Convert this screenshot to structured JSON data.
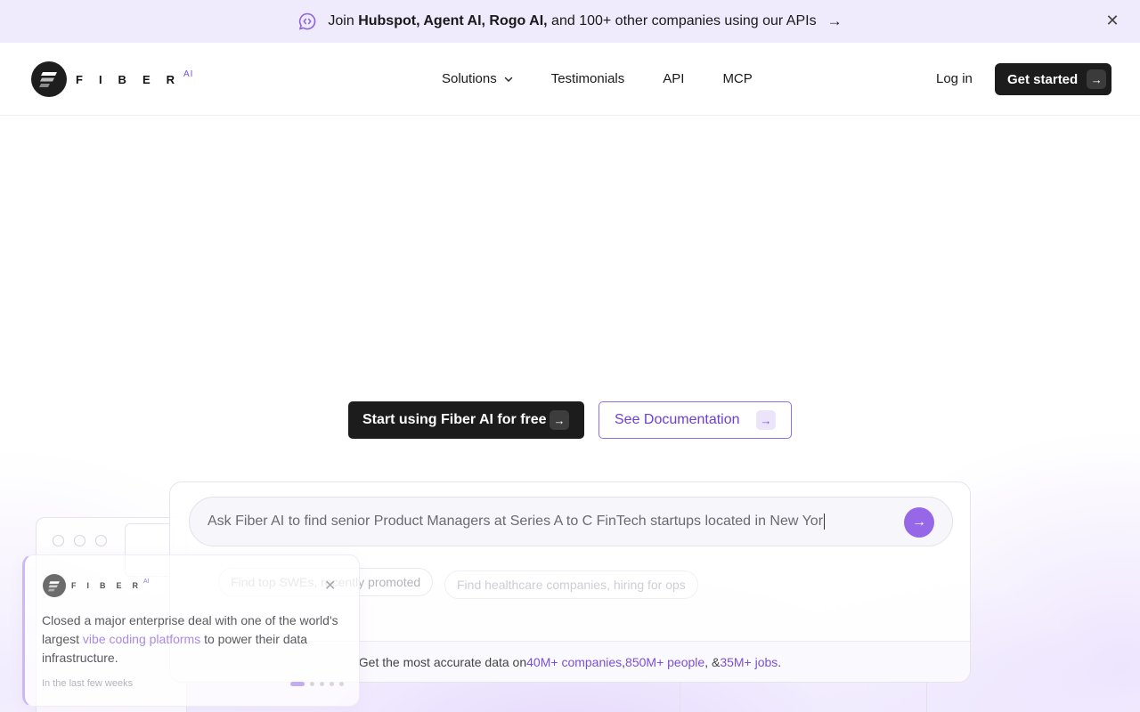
{
  "announcement": {
    "prefix": "Join ",
    "companies": "Hubspot, Agent AI, Rogo AI,",
    "suffix": " and 100+ other companies using our APIs",
    "arrow": "→",
    "close": "✕"
  },
  "brand": {
    "name": "FIBER",
    "sup": "AI"
  },
  "nav": {
    "links": [
      {
        "label": "Solutions",
        "has_dropdown": true
      },
      {
        "label": "Testimonials"
      },
      {
        "label": "API"
      },
      {
        "label": "MCP"
      }
    ],
    "login": "Log in",
    "get_started": "Get started"
  },
  "hero": {
    "primary_cta": "Start using Fiber AI for free",
    "secondary_cta": "See Documentation"
  },
  "search": {
    "typed_text": "Ask Fiber AI to find senior Product Managers at Series A to C FinTech startups located in New Yor",
    "suggestions": [
      "Find top SWEs, recently promoted",
      "Find healthcare companies, hiring for ops"
    ],
    "footer": {
      "prefix": "Get the most accurate data on ",
      "companies": "40M+ companies",
      "sep1": ", ",
      "people": "850M+ people",
      "sep2": ", & ",
      "jobs": "35M+ jobs",
      "end": "."
    }
  },
  "testimonial": {
    "brand": "FIBER",
    "brand_sup": "AI",
    "text_before": "Closed a major enterprise deal with one of the world's largest ",
    "highlight": "vibe coding platforms",
    "text_after": " to power their data infrastructure.",
    "when": "In the last few weeks",
    "pager": {
      "current": 1,
      "total": 5
    }
  },
  "colors": {
    "accent": "#7a4fd9",
    "announce_bg": "#efeafc",
    "dark_button": "#1c1c1c",
    "search_go": "#9668e8"
  }
}
